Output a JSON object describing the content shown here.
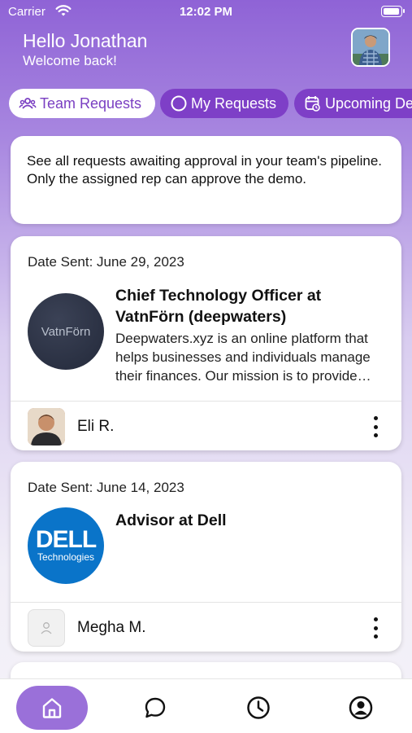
{
  "status_bar": {
    "carrier": "Carrier",
    "time": "12:02 PM"
  },
  "header": {
    "greeting": "Hello Jonathan",
    "subtitle": "Welcome back!"
  },
  "tabs": [
    {
      "label": "Team Requests",
      "icon": "team-icon",
      "active": true
    },
    {
      "label": "My Requests",
      "icon": "circle-icon",
      "active": false
    },
    {
      "label": "Upcoming Demos",
      "icon": "calendar-icon",
      "active": false
    }
  ],
  "info": {
    "text": "See all requests awaiting approval in your team's pipeline. Only the assigned rep can approve the demo."
  },
  "requests": [
    {
      "date_sent": "Date Sent: June 29, 2023",
      "logo_text": "VatnFörn",
      "title": "Chief Technology Officer at VatnFörn (deepwaters)",
      "description": "Deepwaters.xyz is an online platform that helps businesses and individuals manage their finances. Our mission is to provide simple, secure tools.",
      "rep_name": "Eli R."
    },
    {
      "date_sent": "Date Sent: June 14, 2023",
      "logo_text": "DELL",
      "logo_sub": "Technologies",
      "title": "Advisor at Dell",
      "description": "",
      "rep_name": "Megha M."
    }
  ],
  "nav": [
    {
      "icon": "home-icon",
      "active": true
    },
    {
      "icon": "chat-icon",
      "active": false
    },
    {
      "icon": "clock-icon",
      "active": false
    },
    {
      "icon": "profile-icon",
      "active": false
    }
  ],
  "colors": {
    "accent": "#7e3fc7",
    "nav_active": "#9a70d9",
    "gradient_top": "#8f63d6"
  }
}
